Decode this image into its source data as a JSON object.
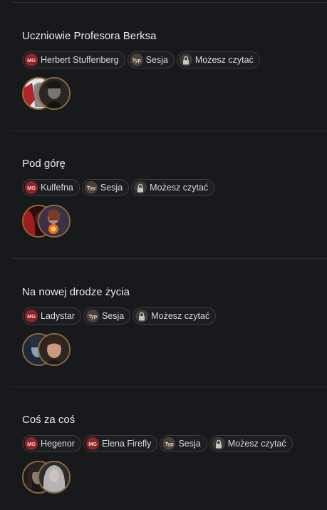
{
  "sessions": [
    {
      "title": "Uczniowie Profesora Berksa",
      "tags": [
        {
          "kind": "mg",
          "badge": "MG",
          "label": "Herbert Stuffenberg"
        },
        {
          "kind": "typ",
          "badge": "Typ",
          "label": "Sesja"
        },
        {
          "kind": "lock",
          "badge": "",
          "label": "Możesz czytać"
        }
      ]
    },
    {
      "title": "Pod górę",
      "tags": [
        {
          "kind": "mg",
          "badge": "MG",
          "label": "Kulfefna"
        },
        {
          "kind": "typ",
          "badge": "Typ",
          "label": "Sesja"
        },
        {
          "kind": "lock",
          "badge": "",
          "label": "Możesz czytać"
        }
      ]
    },
    {
      "title": "Na nowej drodze życia",
      "tags": [
        {
          "kind": "mg",
          "badge": "MG",
          "label": "Ladystar"
        },
        {
          "kind": "typ",
          "badge": "Typ",
          "label": "Sesja"
        },
        {
          "kind": "lock",
          "badge": "",
          "label": "Możesz czytać"
        }
      ]
    },
    {
      "title": "Coś za coś",
      "tags": [
        {
          "kind": "mg",
          "badge": "MG",
          "label": "Hegenor"
        },
        {
          "kind": "mg",
          "badge": "MG",
          "label": "Elena Firefly"
        },
        {
          "kind": "typ",
          "badge": "Typ",
          "label": "Sesja"
        },
        {
          "kind": "lock",
          "badge": "",
          "label": "Możesz czytać"
        }
      ]
    }
  ],
  "colors": {
    "background": "#18191c",
    "mg_badge": "#8e2424",
    "avatar_border": "#8b6a3b"
  }
}
